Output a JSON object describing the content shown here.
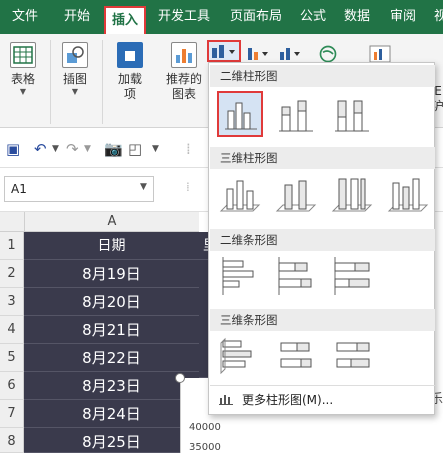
{
  "tabs": [
    "文件",
    "开始",
    "插入",
    "开发工具",
    "页面布局",
    "公式",
    "数据",
    "审阅",
    "视"
  ],
  "active_tab": "插入",
  "ribbon": {
    "table_label": "表格",
    "illustrations_label": "插图",
    "addins_label": "加载",
    "addins_label2": "项",
    "recommended_label": "推荐的",
    "recommended_label2": "图表",
    "right_letter1": "E",
    "right_letter2": "沪"
  },
  "name_box": "A1",
  "columns": [
    "A",
    "日"
  ],
  "row_numbers": [
    "1",
    "2",
    "3",
    "4",
    "5",
    "6",
    "7",
    "8"
  ],
  "column_a": [
    "日期",
    "8月19日",
    "8月20日",
    "8月21日",
    "8月22日",
    "8月23日",
    "8月24日",
    "8月25日"
  ],
  "column_b_header": "里",
  "chart_y_ticks": [
    "40000",
    "35000"
  ],
  "chart_right_text": "乐",
  "gallery": {
    "section_2d_column": "二维柱形图",
    "section_3d_column": "三维柱形图",
    "section_2d_bar": "二维条形图",
    "section_3d_bar": "三维条形图",
    "more_label": "更多柱形图(M)..."
  },
  "colors": {
    "excel_green": "#217346",
    "highlight_red": "#e03a3a",
    "cell_dark": "#3a3a4c"
  }
}
